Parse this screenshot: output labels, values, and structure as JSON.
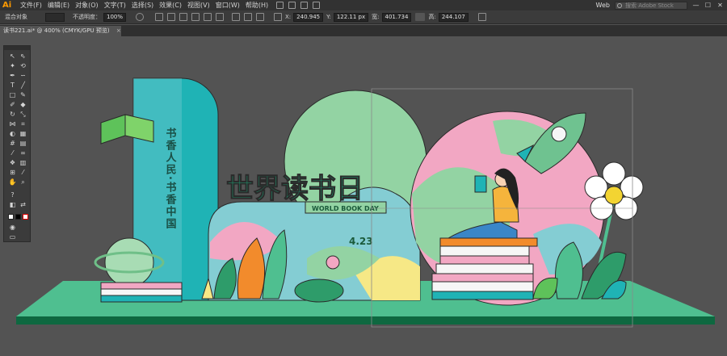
{
  "app": {
    "logo": "Ai",
    "menu": [
      "文件(F)",
      "编辑(E)",
      "对象(O)",
      "文字(T)",
      "选择(S)",
      "效果(C)",
      "视图(V)",
      "窗口(W)",
      "帮助(H)"
    ],
    "workspace": "Web",
    "search_placeholder": "搜索 Adobe Stock",
    "window_buttons": [
      "—",
      "☐",
      "✕"
    ]
  },
  "control_bar": {
    "selection_label": "混合对象",
    "opacity_label": "不透明度：",
    "opacity_value": "100%",
    "x_value": "240.945",
    "y_value": "122.11 px",
    "w_value": "401.734",
    "h_value": "244.107"
  },
  "document": {
    "tab_title": "读书221.ai* @ 400% (CMYK/GPU 预览)",
    "close": "×"
  },
  "artwork": {
    "vertical_slogan": "书香人民·书香中国",
    "headline": "世界读书日",
    "subline": "WORLD BOOK DAY",
    "date": "4.23"
  },
  "colors": {
    "teal": "#1fb3b5",
    "light_teal": "#84cdd3",
    "mint": "#93d3a3",
    "pink": "#f2a7c3",
    "yellow": "#f6e886",
    "platform": "#4fbf90",
    "platform_dark": "#0e6840",
    "orange": "#f28b2c"
  }
}
